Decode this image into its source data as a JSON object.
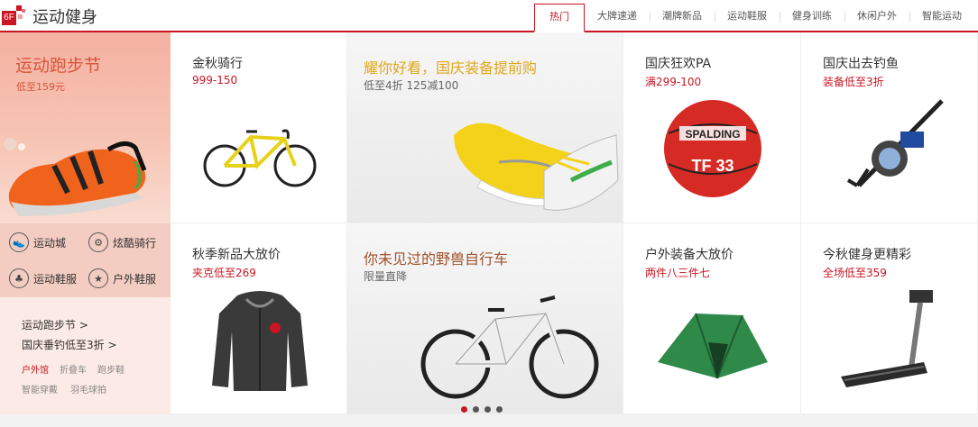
{
  "header": {
    "floor": "6F",
    "title": "运动健身",
    "tabs": [
      {
        "label": "热门",
        "active": true
      },
      {
        "label": "大牌速递"
      },
      {
        "label": "潮牌新品"
      },
      {
        "label": "运动鞋服"
      },
      {
        "label": "健身训练"
      },
      {
        "label": "休闲户外"
      },
      {
        "label": "智能运动"
      }
    ]
  },
  "left": {
    "banner_title": "运动跑步节",
    "banner_sub": "低至159元",
    "categories": [
      "运动城",
      "炫酷骑行",
      "运动鞋服",
      "户外鞋服"
    ],
    "promos": [
      "运动跑步节 >",
      "国庆垂钓低至3折 >"
    ],
    "keywords": [
      "户外馆",
      "折叠车",
      "跑步鞋",
      "智能穿戴",
      "羽毛球拍"
    ]
  },
  "cells": [
    {
      "title": "金秋骑行",
      "sub": "999-150"
    },
    {
      "title": "耀你好看，国庆装备提前购",
      "sub": "低至4折 125减100"
    },
    {
      "title": "国庆狂欢PA",
      "sub": "满299-100"
    },
    {
      "title": "国庆出去钓鱼",
      "sub": "装备低至3折"
    },
    {
      "title": "秋季新品大放价",
      "sub": "夹克低至269"
    },
    {
      "title": "你未见过的野兽自行车",
      "sub": "限量直降"
    },
    {
      "title": "户外装备大放价",
      "sub": "两件八三件七"
    },
    {
      "title": "今秋健身更精彩",
      "sub": "全场低至359"
    }
  ],
  "ball": {
    "brand": "SPALDING",
    "model": "TF 33"
  },
  "colors": {
    "accent": "#c81623",
    "gold": "#e0a718",
    "banner": "#f4b1a1"
  },
  "icons": [
    "running-icon",
    "bike-icon",
    "shirt-icon",
    "hiker-icon"
  ]
}
